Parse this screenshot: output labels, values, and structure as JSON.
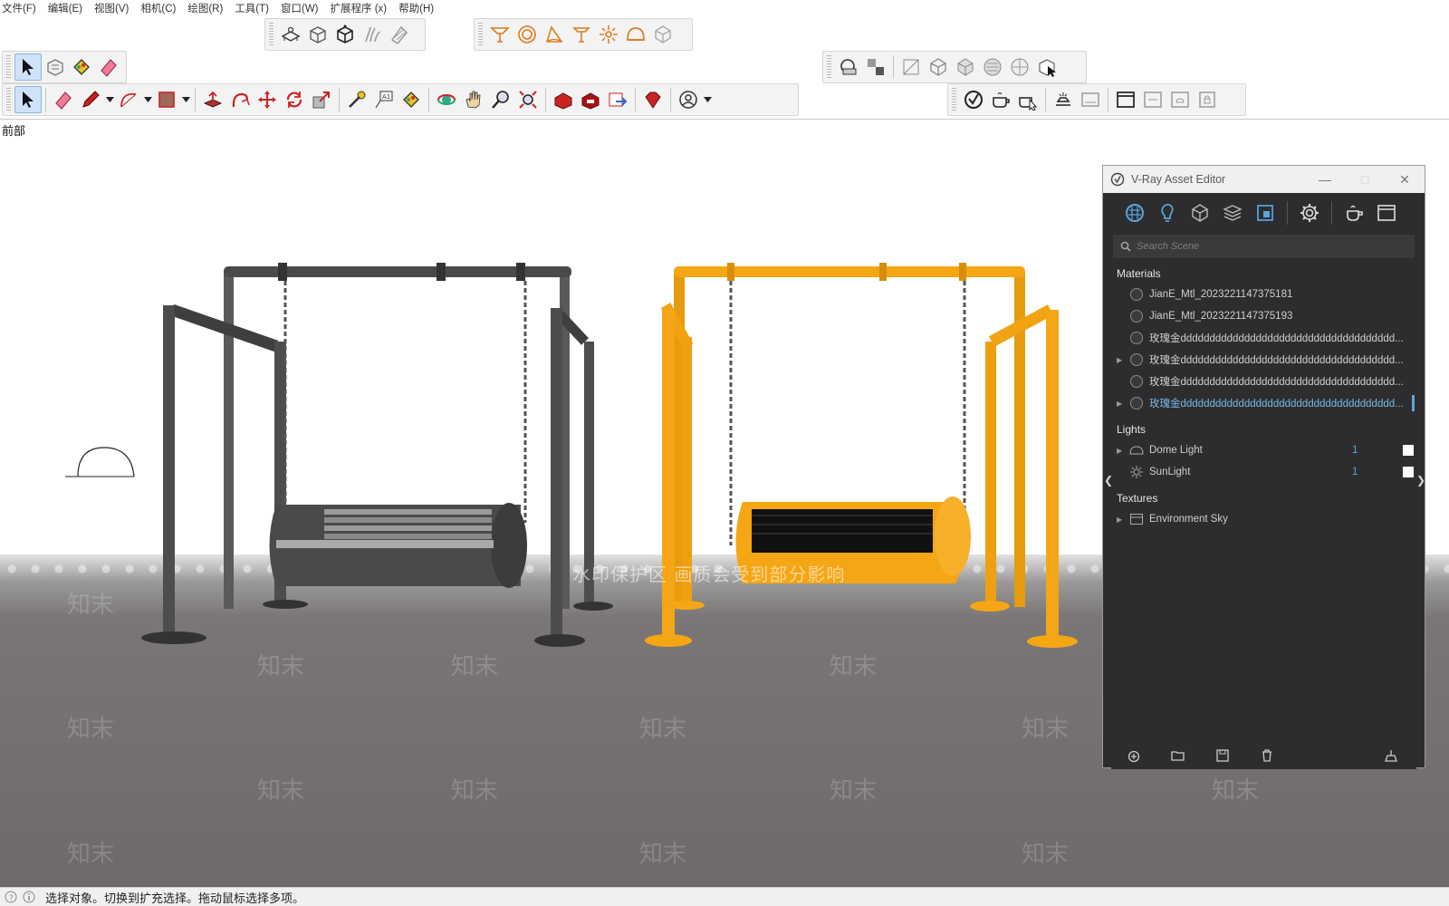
{
  "menu": [
    "文件(F)",
    "编辑(E)",
    "视图(V)",
    "相机(C)",
    "绘图(R)",
    "工具(T)",
    "窗口(W)",
    "扩展程序 (x)",
    "帮助(H)"
  ],
  "viewport": {
    "scene_label": "前部",
    "watermark_text": "知末",
    "watermark_banner": "水印保护区  画质会受到部分影响"
  },
  "toolbars": {
    "views": [
      "iso-icon",
      "top-icon",
      "front-icon",
      "right-icon",
      "back-icon",
      "left-icon"
    ],
    "vray_tools": [
      "vray-light-icon",
      "vray-sphere-light-icon",
      "vray-spot-icon",
      "vray-ies-icon",
      "vray-omni-icon",
      "vray-dome-icon",
      "vray-mesh-light-icon"
    ],
    "small": [
      "select-icon",
      "make-component-icon",
      "paint-bucket-icon",
      "eraser-icon"
    ],
    "main": [
      "select-icon",
      "eraser-icon",
      "pencil-icon",
      "arc-icon",
      "rectangle-icon",
      "push-pull-icon",
      "follow-me-icon",
      "move-icon",
      "rotate-icon",
      "scale-icon",
      "tape-measure-icon",
      "text-icon",
      "paint-bucket-icon",
      "orbit-icon",
      "pan-icon",
      "zoom-icon",
      "zoom-extents-icon",
      "warehouse-icon",
      "extension-warehouse-icon",
      "send-to-layout-icon",
      "ruby-icon",
      "account-icon"
    ],
    "styles": [
      "xray-icon",
      "back-edges-icon",
      "wireframe-icon",
      "hidden-line-icon",
      "shaded-icon",
      "shaded-textures-icon",
      "monochrome-icon",
      "component-select-icon"
    ],
    "render": [
      "vray-logo-icon",
      "render-icon",
      "interactive-render-icon",
      "frame-buffer-icon",
      "lightmix-icon",
      "window-icon",
      "batch-icon",
      "cloud-icon",
      "lock-icon"
    ]
  },
  "vray": {
    "title": "V-Ray Asset Editor",
    "search_placeholder": "Search Scene",
    "sections": {
      "materials": "Materials",
      "lights": "Lights",
      "textures": "Textures"
    },
    "materials": [
      {
        "name": "JianE_Mtl_2023221147375181",
        "expandable": false,
        "selected": false
      },
      {
        "name": "JianE_Mtl_2023221147375193",
        "expandable": false,
        "selected": false
      },
      {
        "name": "玫瑰金ddddddddddddddddddddddddddddddddddddd...",
        "expandable": false,
        "selected": false
      },
      {
        "name": "玫瑰金ddddddddddddddddddddddddddddddddddddd...",
        "expandable": true,
        "selected": false
      },
      {
        "name": "玫瑰金ddddddddddddddddddddddddddddddddddddd...",
        "expandable": false,
        "selected": false
      },
      {
        "name": "玫瑰金ddddddddddddddddddddddddddddddddddddd...",
        "expandable": true,
        "selected": true
      }
    ],
    "lights": [
      {
        "name": "Dome Light",
        "count": "1",
        "icon": "dome-light-icon"
      },
      {
        "name": "SunLight",
        "count": "1",
        "icon": "sun-icon"
      }
    ],
    "textures": [
      {
        "name": "Environment Sky",
        "icon": "texture-icon"
      }
    ]
  },
  "status": {
    "text": "选择对象。切换到扩充选择。拖动鼠标选择多项。"
  },
  "colors": {
    "swing_yellow": "#f5a614",
    "swing_gray": "#4a4a4a",
    "vray_panel": "#2d2d2f",
    "vray_accent": "#5aa6de"
  }
}
